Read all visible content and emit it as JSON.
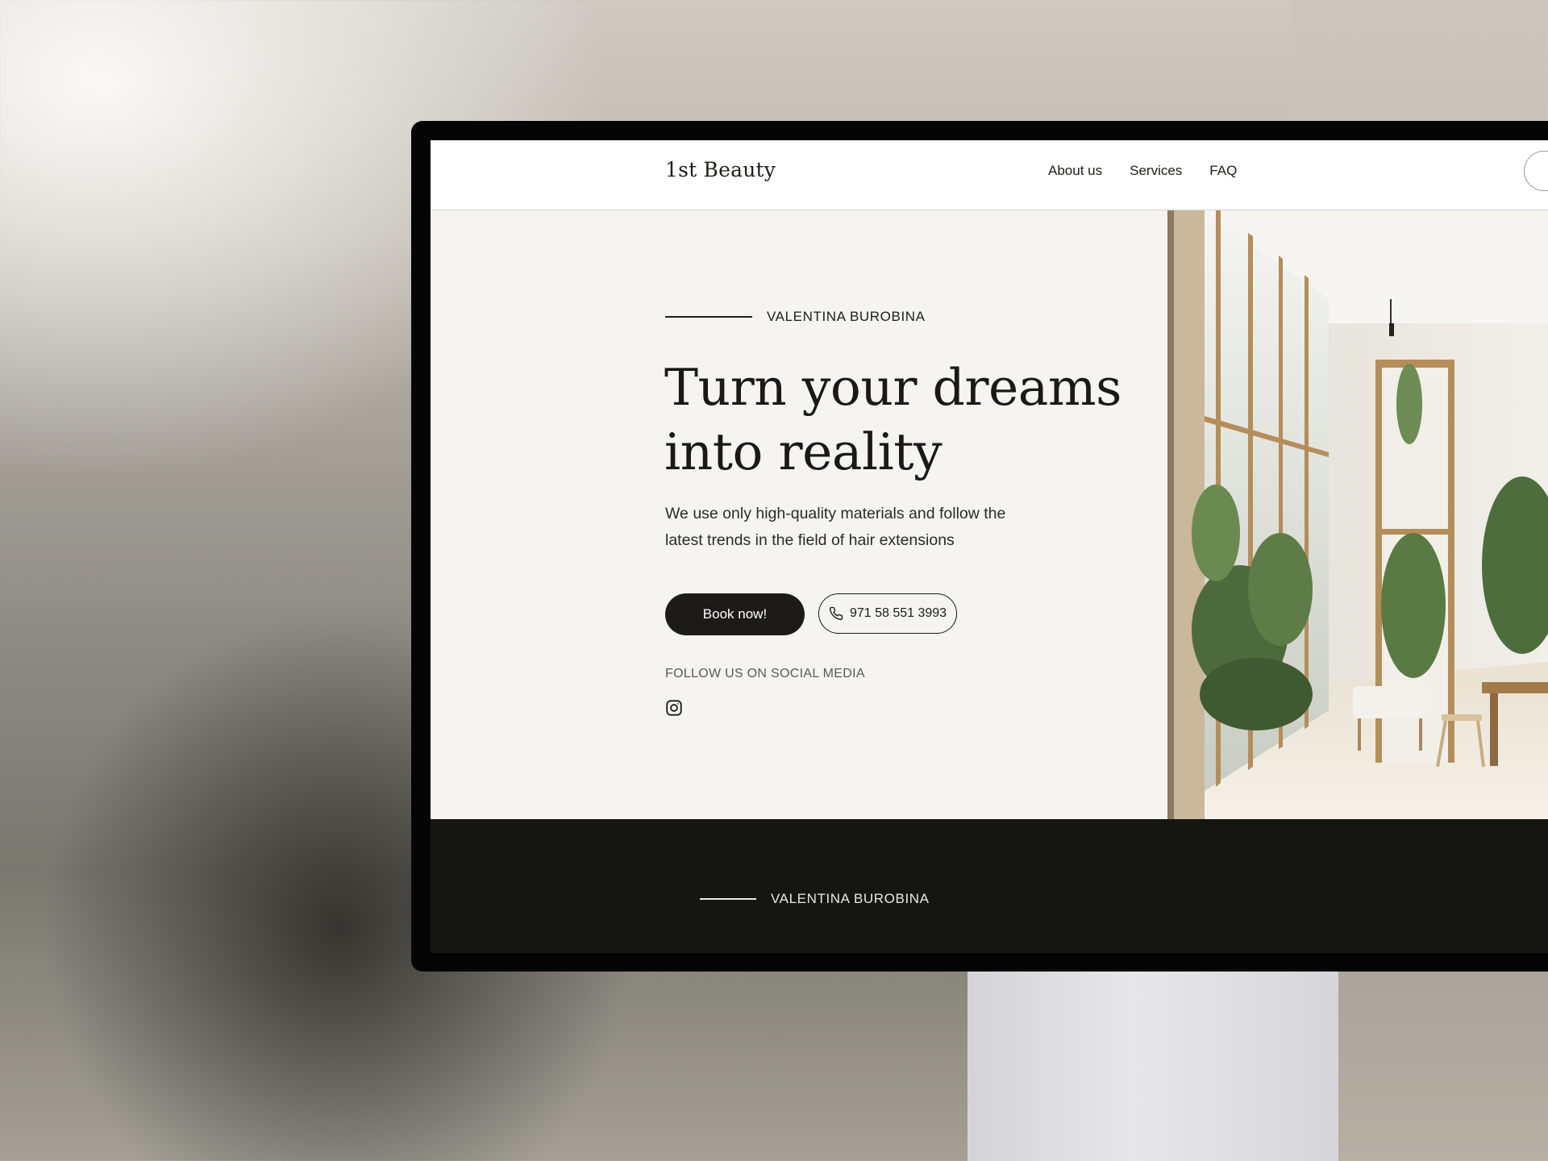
{
  "site": {
    "logo": "1st Beauty",
    "nav": [
      "About us",
      "Services",
      "FAQ"
    ]
  },
  "hero": {
    "eyebrow": "VALENTINA BUROBINA",
    "title_line1": "Turn your dreams",
    "title_line2": "into reality",
    "subtitle_line1": "We use only high-quality materials and follow the",
    "subtitle_line2": "latest trends in the field of hair extensions",
    "book_button": "Book now!",
    "phone": "971 58 551 3993",
    "follow_label": "FOLLOW US ON SOCIAL MEDIA",
    "social_icons": [
      "instagram-icon"
    ],
    "image_description_icon": "interior-photo"
  },
  "dark_section": {
    "eyebrow": "VALENTINA BUROBINA"
  },
  "colors": {
    "accent_dark": "#1c1b18",
    "hero_bg": "#f5f4f2",
    "band_bg": "#151611",
    "header_bg": "#ffffff"
  }
}
